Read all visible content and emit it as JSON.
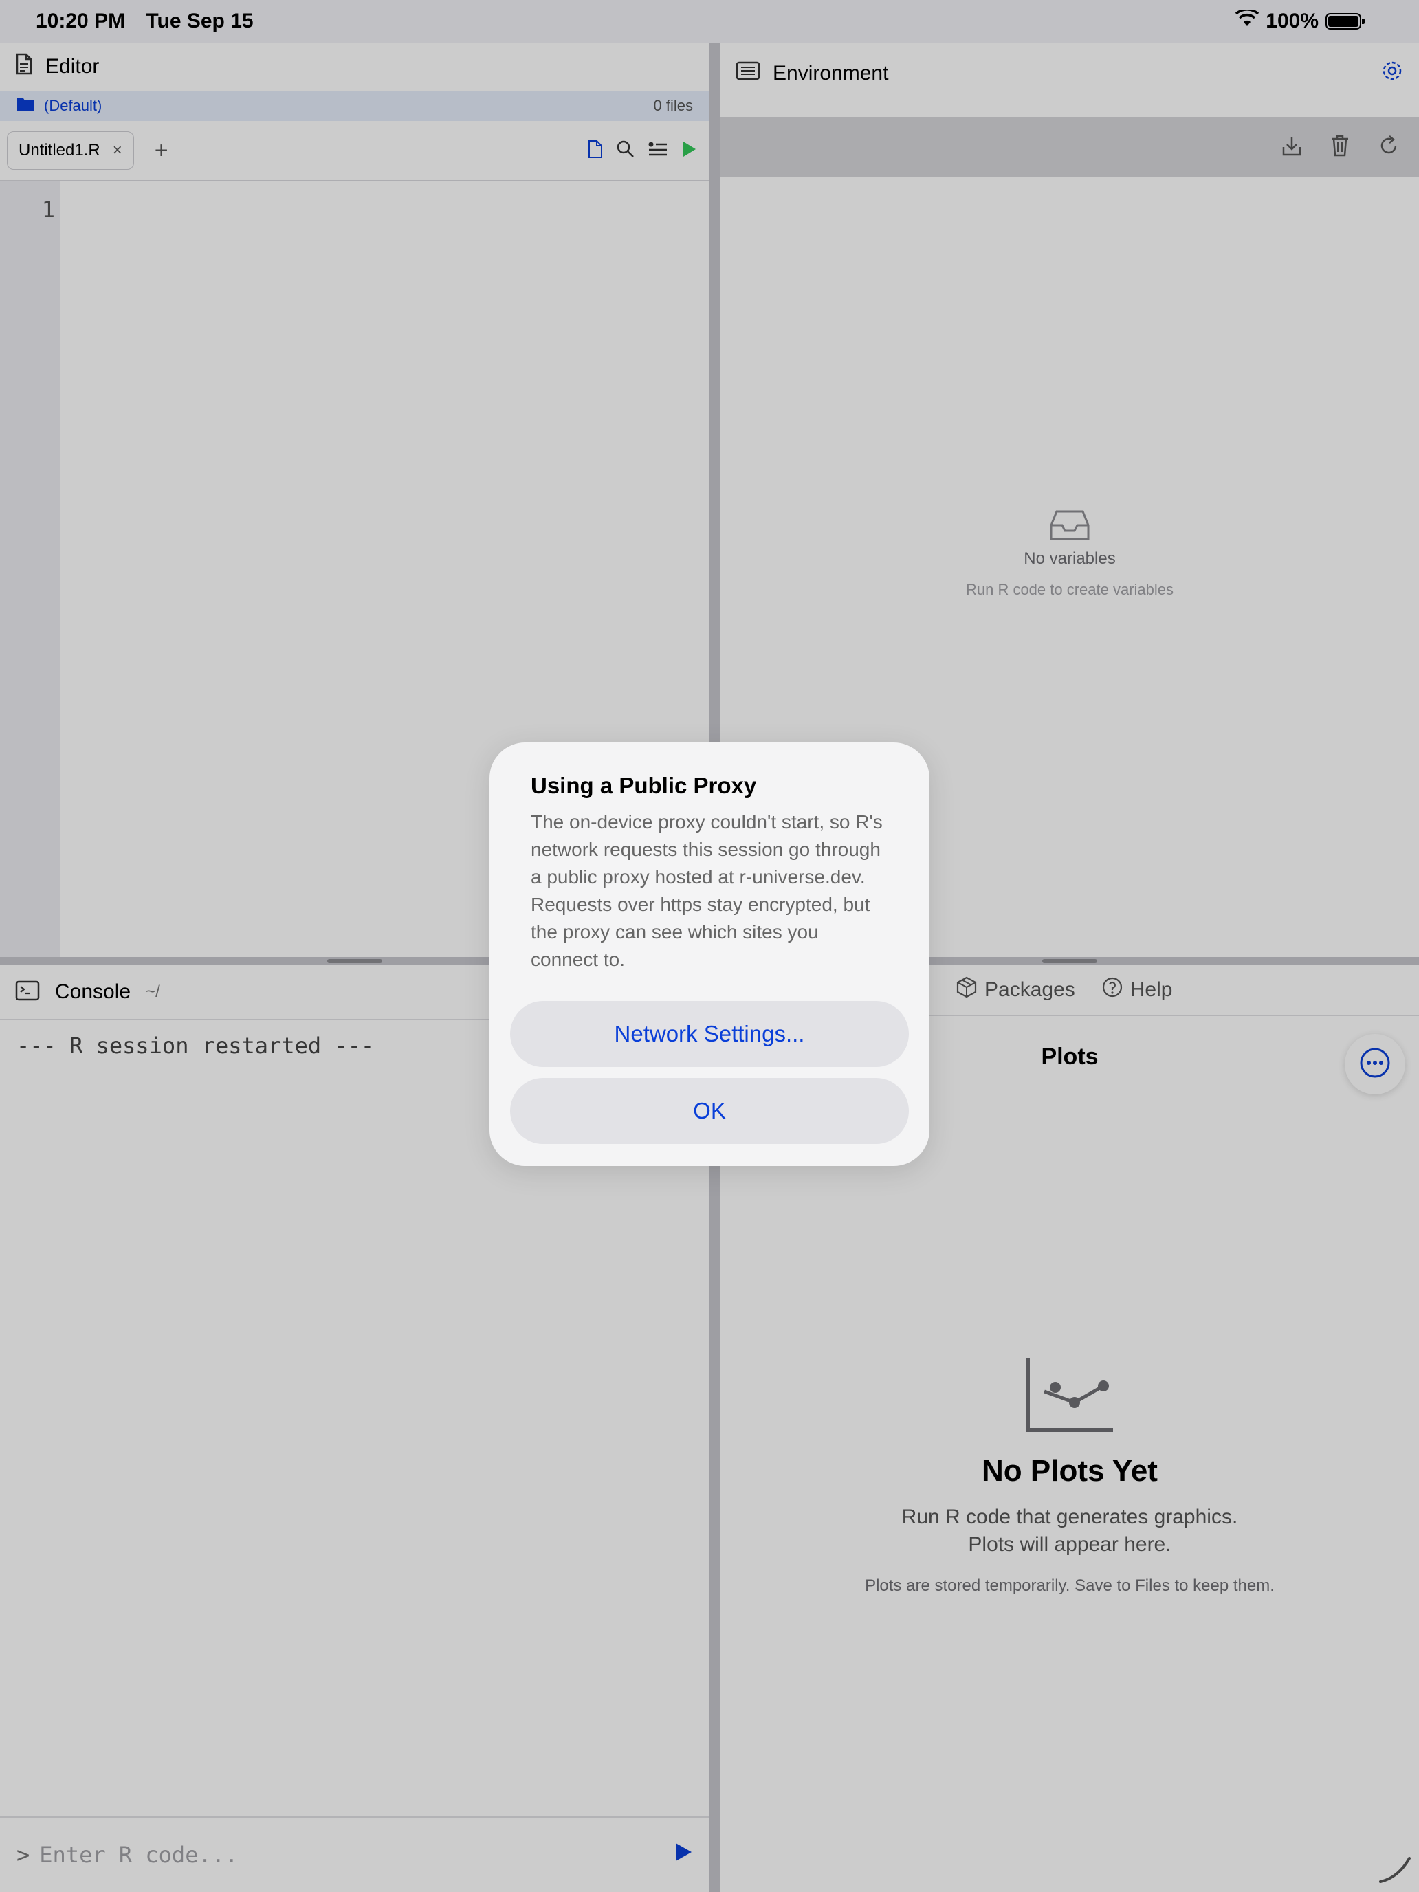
{
  "status_bar": {
    "time": "10:20 PM",
    "date": "Tue Sep 15",
    "battery": "100%",
    "icons": [
      "wifi-icon",
      "battery-icon"
    ]
  },
  "editor": {
    "title": "Editor",
    "project": "(Default)",
    "file_count": "0 files",
    "tab_name": "Untitled1.R",
    "tab_close": "×",
    "add_tab": "+",
    "line_number": "1",
    "toolbar_icons": [
      "new-file-icon",
      "search-icon",
      "outline-icon",
      "run-icon"
    ]
  },
  "environment": {
    "title": "Environment",
    "toolbar_icons": [
      "import-icon",
      "trash-icon",
      "refresh-icon"
    ],
    "empty_title": "No variables",
    "empty_subtitle": "Run R code to create variables"
  },
  "console": {
    "title": "Console",
    "path": "~/",
    "output_line": "--- R session restarted ---",
    "prompt": ">",
    "input_placeholder": "Enter R code..."
  },
  "plots": {
    "tabs": [
      {
        "label": "Packages",
        "icon": "package-icon"
      },
      {
        "label": "Help",
        "icon": "help-icon"
      }
    ],
    "title": "Plots",
    "empty_title": "No Plots Yet",
    "empty_line1": "Run R code that generates graphics.",
    "empty_line2": "Plots will appear here.",
    "note": "Plots are stored temporarily. Save to Files to keep them."
  },
  "alert": {
    "title": "Using a Public Proxy",
    "message": "The on-device proxy couldn't start, so R's network requests this session go through a public proxy hosted at r-universe.dev. Requests over https stay encrypted, but the proxy can see which sites you connect to.",
    "primary_button": "Network Settings...",
    "ok_button": "OK"
  },
  "colors": {
    "accent": "#0a3fd8",
    "run_green": "#34c759",
    "alert_bg": "#f4f4f5"
  }
}
